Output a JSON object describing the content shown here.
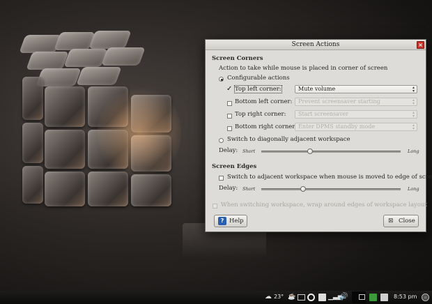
{
  "dialog": {
    "title": "Screen Actions",
    "corners": {
      "heading": "Screen Corners",
      "description": "Action to take while mouse is placed in corner of screen",
      "configurable_label": "Configurable actions",
      "rows": [
        {
          "label": "Top left corner:",
          "checked": true,
          "value": "Mute volume",
          "enabled": true
        },
        {
          "label": "Bottom left corner:",
          "checked": false,
          "value": "Prevent screensaver starting",
          "enabled": false
        },
        {
          "label": "Top right corner:",
          "checked": false,
          "value": "Start screensaver",
          "enabled": false
        },
        {
          "label": "Bottom right corner:",
          "checked": false,
          "value": "Enter DPMS standby mode",
          "enabled": false
        }
      ],
      "diagonal_label": "Switch to diagonally adjacent workspace",
      "delay_label": "Delay:",
      "delay_min": "Short",
      "delay_max": "Long",
      "delay_value": 0.35
    },
    "edges": {
      "heading": "Screen Edges",
      "switch_label": "Switch to adjacent workspace when mouse is moved to edge of screen",
      "delay_label": "Delay:",
      "delay_min": "Short",
      "delay_max": "Long",
      "delay_value": 0.3,
      "wrap_label": "When switching workspace, wrap around edges of workspace layout"
    },
    "help_label": "Help",
    "close_label": "Close"
  },
  "taskbar": {
    "temperature": "23°",
    "clock": "8:53 pm"
  },
  "colors": {
    "dialog_bg": "#dddcd8",
    "close_red": "#c8342a",
    "help_blue": "#2a5fb0"
  }
}
